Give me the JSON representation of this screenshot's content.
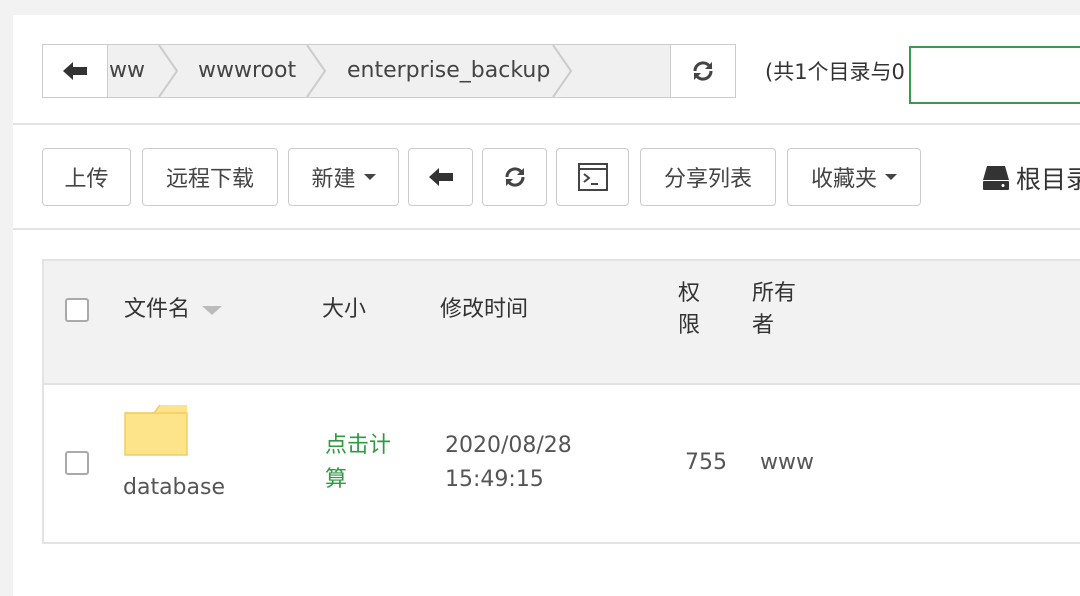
{
  "pathbar": {
    "crumbs": [
      "ww",
      "wwwroot",
      "enterprise_backup"
    ]
  },
  "summary": "(共1个目录与0",
  "search": {
    "value": ""
  },
  "toolbar": {
    "upload": "上传",
    "remote_download": "远程下载",
    "new": "新建",
    "share_list": "分享列表",
    "favorites": "收藏夹",
    "root_dir": "根目录"
  },
  "table": {
    "headers": {
      "name": "文件名",
      "size": "大小",
      "modified": "修改时间",
      "permission": "权限",
      "owner": "所有者"
    },
    "rows": [
      {
        "name": "database",
        "size": "点击计算",
        "modified": "2020/08/28 15:49:15",
        "permission": "755",
        "owner": "www"
      }
    ]
  },
  "colors": {
    "accent_green": "#2e9b41",
    "folder_yellow": "#fde38a"
  }
}
